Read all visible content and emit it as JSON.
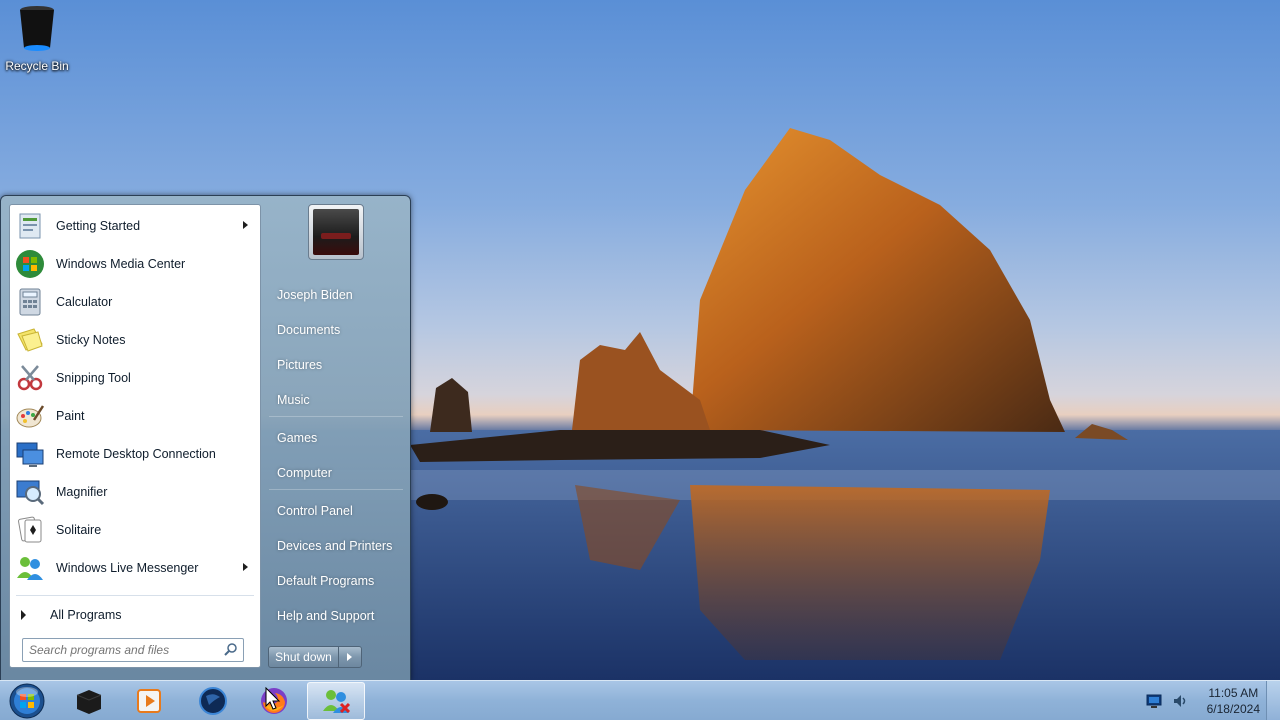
{
  "desktop": {
    "icons": [
      {
        "label": "Recycle Bin",
        "icon": "recycle-bin-icon"
      }
    ]
  },
  "start_menu": {
    "programs": [
      {
        "label": "Getting Started",
        "icon": "getting-started-icon",
        "has_submenu": true
      },
      {
        "label": "Windows Media Center",
        "icon": "media-center-icon",
        "has_submenu": false
      },
      {
        "label": "Calculator",
        "icon": "calculator-icon",
        "has_submenu": false
      },
      {
        "label": "Sticky Notes",
        "icon": "sticky-notes-icon",
        "has_submenu": false
      },
      {
        "label": "Snipping Tool",
        "icon": "snipping-tool-icon",
        "has_submenu": false
      },
      {
        "label": "Paint",
        "icon": "paint-icon",
        "has_submenu": false
      },
      {
        "label": "Remote Desktop Connection",
        "icon": "remote-desktop-icon",
        "has_submenu": false
      },
      {
        "label": "Magnifier",
        "icon": "magnifier-icon",
        "has_submenu": false
      },
      {
        "label": "Solitaire",
        "icon": "solitaire-icon",
        "has_submenu": false
      },
      {
        "label": "Windows Live Messenger",
        "icon": "messenger-icon",
        "has_submenu": true
      }
    ],
    "all_programs_label": "All Programs",
    "search": {
      "placeholder": "Search programs and files",
      "value": ""
    },
    "right_links": [
      {
        "label": "Joseph Biden"
      },
      {
        "label": "Documents"
      },
      {
        "label": "Pictures"
      },
      {
        "label": "Music"
      },
      {
        "label": "Games"
      },
      {
        "label": "Computer"
      },
      {
        "label": "Control Panel"
      },
      {
        "label": "Devices and Printers"
      },
      {
        "label": "Default Programs"
      },
      {
        "label": "Help and Support"
      }
    ],
    "shutdown_label": "Shut down"
  },
  "taskbar": {
    "pinned": [
      {
        "icon": "terminal-icon"
      },
      {
        "icon": "media-player-icon"
      },
      {
        "icon": "globe-icon"
      },
      {
        "icon": "firefox-icon"
      },
      {
        "icon": "users-icon",
        "active": true
      }
    ],
    "tray": {
      "icons": [
        "monitor-icon",
        "volume-icon"
      ],
      "time": "11:05 AM",
      "date": "6/18/2024"
    }
  },
  "colors": {
    "taskbar": "#8fb2d8",
    "start_menu_glass": "#7e97ad",
    "accent_blue": "#1f6fd0"
  }
}
